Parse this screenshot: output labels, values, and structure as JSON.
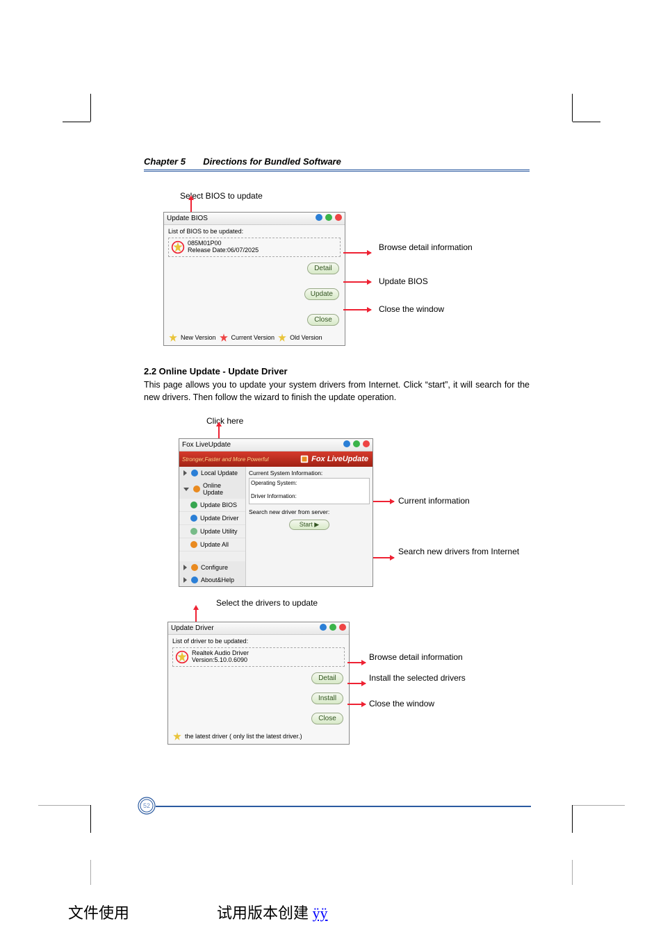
{
  "chapter": {
    "label": "Chapter 5",
    "title": "Directions for Bundled Software"
  },
  "bios_box": {
    "caption": "Select BIOS to update",
    "title": "Update BIOS",
    "sublabel": "List of BIOS to be updated:",
    "item_line1": "085M01P00",
    "item_line2": "Release Date:06/07/2025",
    "btn_detail": "Detail",
    "btn_update": "Update",
    "btn_close": "Close",
    "legend_new": "New Version",
    "legend_current": "Current Version",
    "legend_old": "Old Version"
  },
  "bios_callouts": {
    "detail": "Browse detail information",
    "update": "Update BIOS",
    "close": "Close the window"
  },
  "section": {
    "heading": "2.2 Online Update - Update Driver",
    "paragraph": "This page allows you to update your system drivers from Internet. Click “start”, it will search for the new drivers. Then follow the wizard to finish the update operation."
  },
  "fox": {
    "caption": "Click here",
    "title": "Fox LiveUpdate",
    "banner_slogan": "Stronger,Faster and More Powerful",
    "brand": "Fox LiveUpdate",
    "nav_local": "Local Update",
    "nav_online": "Online Update",
    "nav_bios": "Update BIOS",
    "nav_driver": "Update Driver",
    "nav_utility": "Update Utility",
    "nav_all": "Update All",
    "nav_configure": "Configure",
    "nav_about": "About&Help",
    "panel1_label": "Current System Information:",
    "panel1_a": "Operating System:",
    "panel1_b": "Driver Information:",
    "panel2_label": "Search new driver from server:",
    "start": "Start"
  },
  "fox_callouts": {
    "current": "Current information",
    "search": "Search new drivers from Internet"
  },
  "driver_box": {
    "caption": "Select the drivers to update",
    "title": "Update Driver",
    "sublabel": "List of driver to be updated:",
    "item_line1": "Realtek Audio Driver",
    "item_line2": "Version:5.10.0.6090",
    "btn_detail": "Detail",
    "btn_install": "Install",
    "btn_close": "Close",
    "legend": "the latest driver ( only list the latest driver.)"
  },
  "driver_callouts": {
    "detail": "Browse detail information",
    "install": "Install the selected drivers",
    "close": "Close the window"
  },
  "page_number": "52",
  "footer": {
    "left_cn": "文件使用",
    "right_prefix": "试用版本创建",
    "link": "ÿÿ"
  }
}
